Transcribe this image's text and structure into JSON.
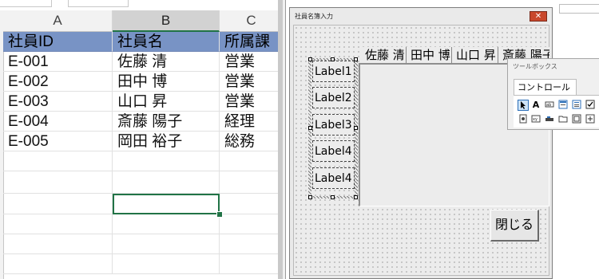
{
  "sheet": {
    "columns": [
      {
        "letter": "A",
        "selected": false
      },
      {
        "letter": "B",
        "selected": true
      },
      {
        "letter": "C",
        "selected": false
      }
    ],
    "header_row": [
      "社員ID",
      "社員名",
      "所属課"
    ],
    "rows": [
      [
        "E-001",
        "佐藤 清",
        "営業"
      ],
      [
        "E-002",
        "田中 博",
        "営業"
      ],
      [
        "E-003",
        "山口 昇",
        "営業"
      ],
      [
        "E-004",
        "斎藤 陽子",
        "経理"
      ],
      [
        "E-005",
        "岡田 裕子",
        "総務"
      ]
    ],
    "colors": {
      "header_fill": "#7893c5",
      "selection": "#217346"
    }
  },
  "userform": {
    "title": "社員名簿入力",
    "close_glyph": "✕",
    "list_headers": [
      "佐藤 清",
      "田中 博",
      "山口 昇",
      "斎藤 陽子"
    ],
    "labels": [
      "Label1",
      "Label2",
      "Label3",
      "Label4",
      "Label4"
    ],
    "close_button": "閉じる"
  },
  "toolbox": {
    "title": "ツールボックス",
    "tab": "コントロール",
    "tools_row1": [
      "pointer-icon",
      "label-tool-icon",
      "textbox-tool-icon",
      "combobox-tool-icon",
      "listbox-tool-icon",
      "checkbox-tool-icon"
    ],
    "tools_row2": [
      "optionbutton-tool-icon",
      "togglebutton-tool-icon",
      "frame-tool-icon",
      "commandbutton-tool-icon",
      "tabstrip-tool-icon",
      "multipage-tool-icon"
    ]
  }
}
